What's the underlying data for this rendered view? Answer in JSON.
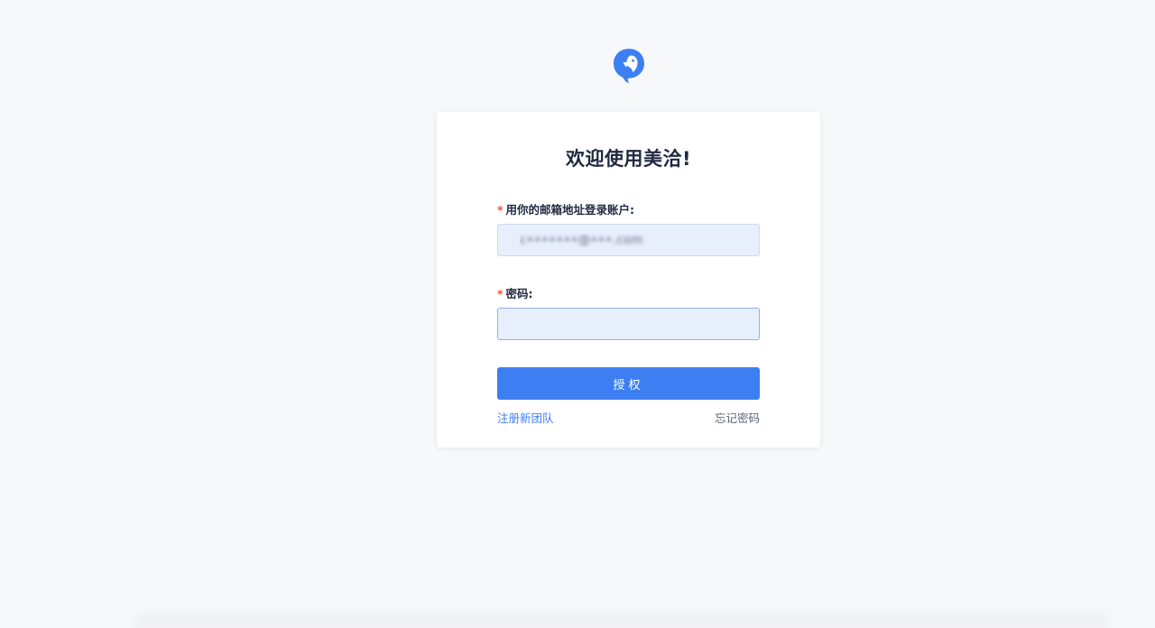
{
  "brand": {
    "logo_icon": "bird-chat-bubble-icon",
    "accent_color": "#3d7ff2"
  },
  "login": {
    "title": "欢迎使用美洽!",
    "required_mark": "*",
    "email_label": "用你的邮箱地址登录账户:",
    "email_value": "c•••••••@•••.com",
    "password_label": "密码:",
    "password_value": "",
    "submit_label": "授权",
    "register_link": "注册新团队",
    "forgot_link": "忘记密码"
  }
}
